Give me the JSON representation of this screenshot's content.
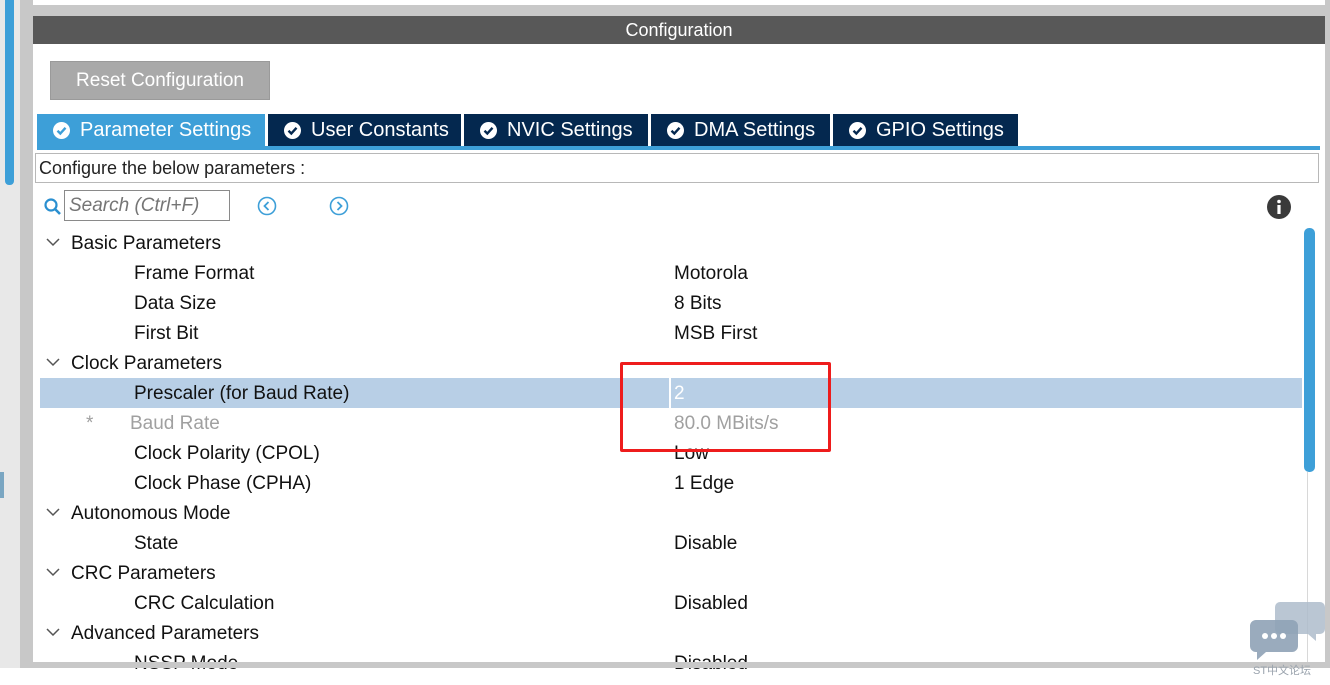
{
  "window": {
    "title": "Configuration"
  },
  "toolbar": {
    "reset_label": "Reset Configuration"
  },
  "tabs": [
    {
      "label": "Parameter Settings",
      "active": true
    },
    {
      "label": "User Constants",
      "active": false
    },
    {
      "label": "NVIC Settings",
      "active": false
    },
    {
      "label": "DMA Settings",
      "active": false
    },
    {
      "label": "GPIO Settings",
      "active": false
    }
  ],
  "hint": "Configure the below parameters :",
  "search": {
    "placeholder": "Search (Ctrl+F)"
  },
  "groups": {
    "basic": "Basic Parameters",
    "clock": "Clock Parameters",
    "autonomous": "Autonomous Mode",
    "crc": "CRC Parameters",
    "advanced": "Advanced Parameters"
  },
  "params": {
    "frame_format": {
      "name": "Frame Format",
      "value": "Motorola"
    },
    "data_size": {
      "name": "Data Size",
      "value": "8 Bits"
    },
    "first_bit": {
      "name": "First Bit",
      "value": "MSB First"
    },
    "prescaler": {
      "name": "Prescaler (for Baud Rate)",
      "value": "2"
    },
    "baud_rate": {
      "name": "Baud Rate",
      "value": "80.0 MBits/s",
      "marker": "*"
    },
    "cpol": {
      "name": "Clock Polarity (CPOL)",
      "value": "Low"
    },
    "cpha": {
      "name": "Clock Phase (CPHA)",
      "value": "1 Edge"
    },
    "state": {
      "name": "State",
      "value": "Disable"
    },
    "crc_calc": {
      "name": "CRC Calculation",
      "value": "Disabled"
    },
    "nssp": {
      "name": "NSSP Mode",
      "value": "Disabled"
    }
  },
  "watermark": {
    "text": "ST中文论坛"
  },
  "colors": {
    "accent": "#3d9fd8",
    "tab_bg": "#04284f",
    "highlight": "#ee1c1c",
    "selection": "#b8cfe6"
  }
}
